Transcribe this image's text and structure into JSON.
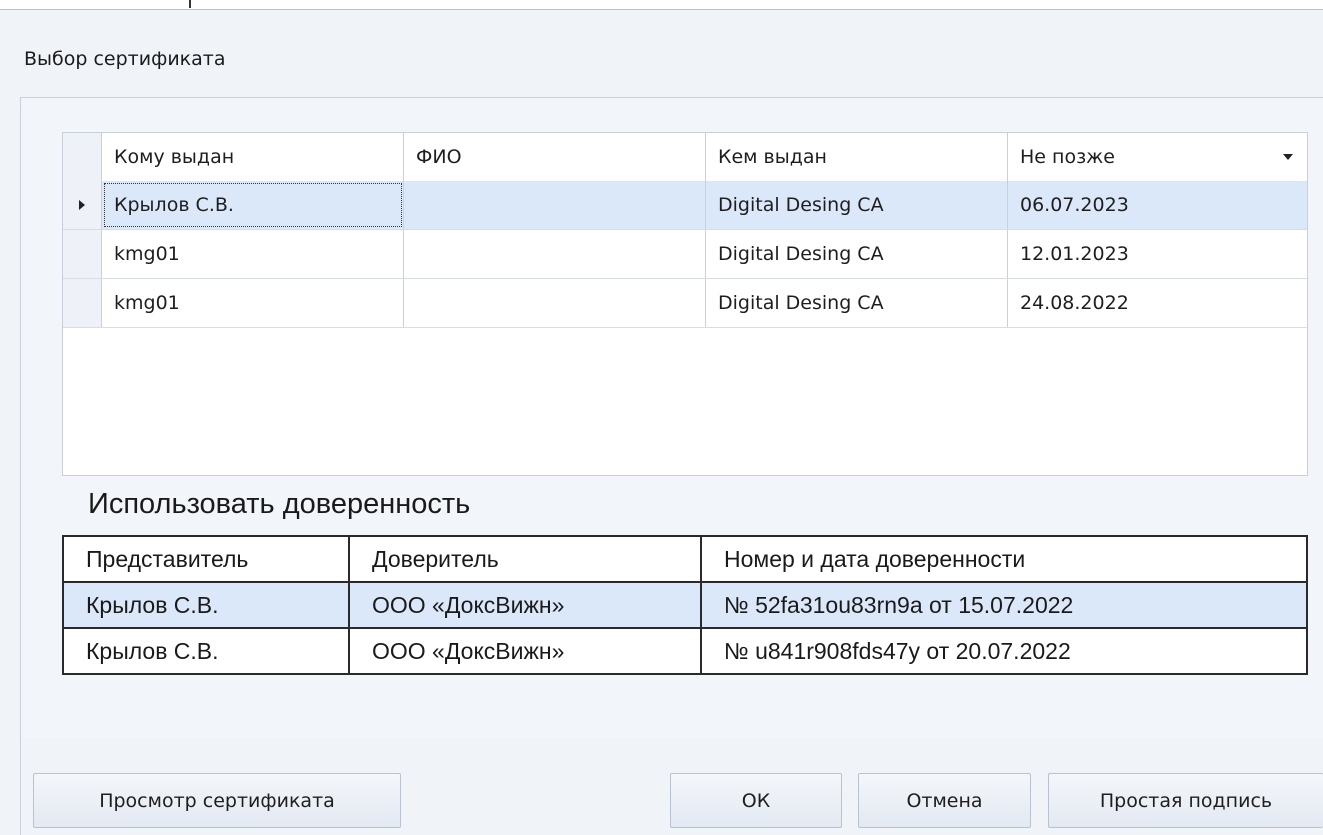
{
  "dialog": {
    "title": "Выбор сертификата"
  },
  "certificates": {
    "columns": [
      "Кому выдан",
      "ФИО",
      "Кем выдан",
      "Не позже"
    ],
    "rows": [
      {
        "to": "Крылов С.В.",
        "fio": "",
        "by": "Digital Desing CA",
        "date": "06.07.2023",
        "selected": true
      },
      {
        "to": "kmg01",
        "fio": "",
        "by": "Digital Desing CA",
        "date": "12.01.2023",
        "selected": false
      },
      {
        "to": "kmg01",
        "fio": "",
        "by": "Digital Desing CA",
        "date": "24.08.2022",
        "selected": false
      }
    ]
  },
  "attorney": {
    "title": "Использовать доверенность",
    "columns": [
      "Представитель",
      "Доверитель",
      "Номер и дата доверенности"
    ],
    "rows": [
      {
        "rep": "Крылов С.В.",
        "principal": "ООО «ДоксВижн»",
        "number": "№ 52fa31ou83rn9a от 15.07.2022",
        "selected": true
      },
      {
        "rep": "Крылов С.В.",
        "principal": "ООО «ДоксВижн»",
        "number": "№ u841r908fds47y от 20.07.2022",
        "selected": false
      }
    ]
  },
  "buttons": {
    "view": "Просмотр сертификата",
    "ok": "ОК",
    "cancel": "Отмена",
    "simple": "Простая подпись"
  },
  "colors": {
    "selected_row": "#dbe8fa",
    "panel_bg": "#f2f5fa"
  }
}
